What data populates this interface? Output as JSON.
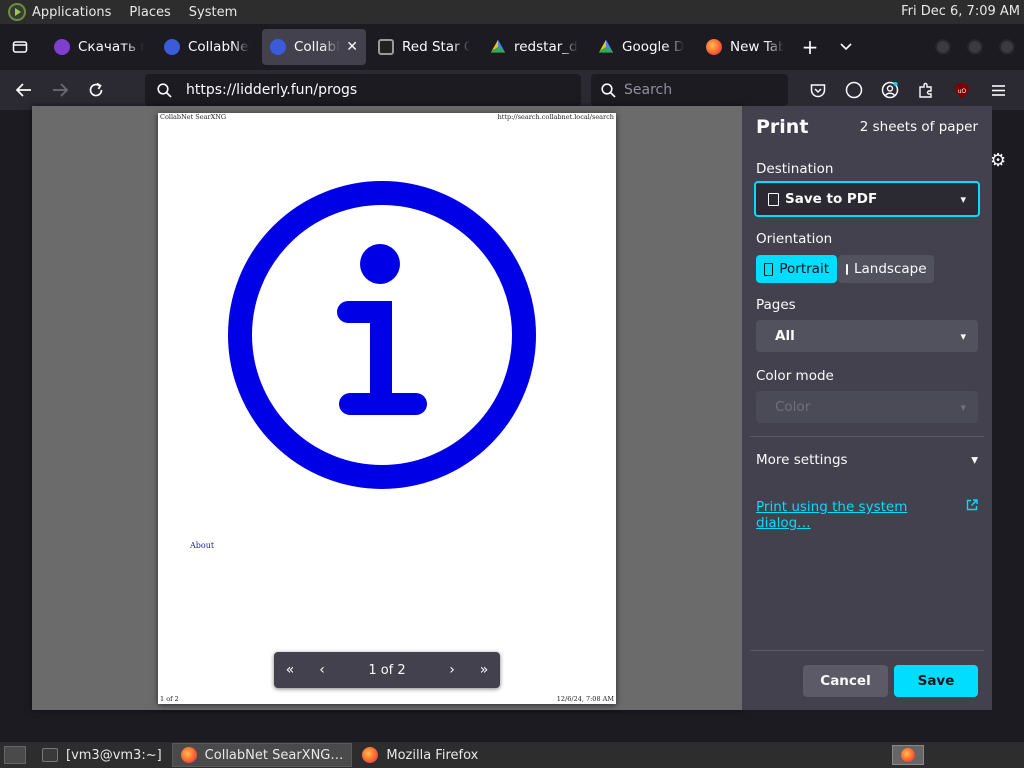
{
  "panel": {
    "menus": [
      "Applications",
      "Places",
      "System"
    ],
    "clock": "Fri Dec  6,  7:09 AM"
  },
  "tabs": [
    {
      "title": "Скачать п",
      "favicon": "purple-app-icon",
      "color": "#7e3fd1",
      "active": false
    },
    {
      "title": "CollabNet",
      "favicon": "collabnet-icon",
      "color": "#3b5bdb",
      "active": false
    },
    {
      "title": "CollabN",
      "favicon": "collabnet-icon",
      "color": "#3b5bdb",
      "active": true
    },
    {
      "title": "Red Star C",
      "favicon": "monitor-icon",
      "color": "#9a9a9a",
      "active": false
    },
    {
      "title": "redstar_d",
      "favicon": "google-drive-icon",
      "color": "#34a853",
      "active": false
    },
    {
      "title": "Google D",
      "favicon": "google-drive-icon",
      "color": "#fbbc04",
      "active": false
    },
    {
      "title": "New Tab",
      "favicon": "firefox-icon",
      "color": "#ff7139",
      "active": false
    }
  ],
  "navbar": {
    "url": "https://lidderly.fun/progs",
    "search_placeholder": "Search"
  },
  "preview": {
    "header_left": "CollabNet SearXNG",
    "header_right": "http://search.collabnet.local/search",
    "footer_left": "1 of 2",
    "footer_right": "12/6/24, 7:08 AM",
    "about_link": "About",
    "icon_color": "#0000e6",
    "page_indicator": "1 of 2"
  },
  "print": {
    "title": "Print",
    "sheets": "2 sheets of paper",
    "destination_label": "Destination",
    "destination_value": "Save to PDF",
    "orientation_label": "Orientation",
    "portrait_label": "Portrait",
    "landscape_label": "Landscape",
    "pages_label": "Pages",
    "pages_value": "All",
    "color_mode_label": "Color mode",
    "color_mode_value": "Color",
    "more_settings": "More settings",
    "system_dialog": "Print using the system dialog…",
    "cancel": "Cancel",
    "save": "Save",
    "accent": "#00ddff"
  },
  "taskbar": {
    "tasks": [
      {
        "label": "[vm3@vm3:~]",
        "icon": "terminal-icon",
        "active": false
      },
      {
        "label": "CollabNet SearXNG…",
        "icon": "firefox-icon",
        "active": true
      },
      {
        "label": "Mozilla Firefox",
        "icon": "firefox-icon",
        "active": false
      }
    ]
  }
}
